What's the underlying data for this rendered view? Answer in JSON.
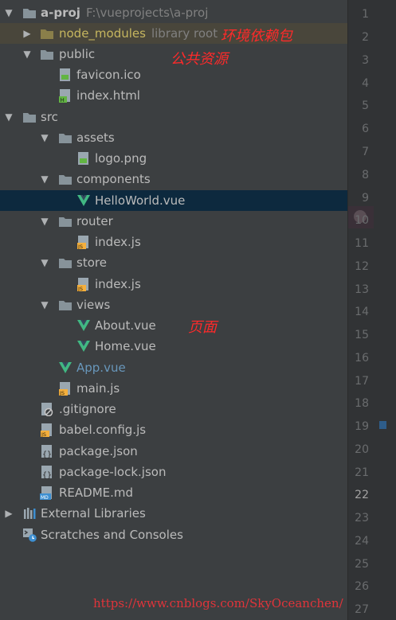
{
  "project": {
    "name": "a-proj",
    "path": "F:\\vueprojects\\a-proj"
  },
  "tree": [
    {
      "label": "node_modules",
      "extra": "library root"
    },
    {
      "label": "public"
    },
    {
      "label": "favicon.ico"
    },
    {
      "label": "index.html"
    },
    {
      "label": "src"
    },
    {
      "label": "assets"
    },
    {
      "label": "logo.png"
    },
    {
      "label": "components"
    },
    {
      "label": "HelloWorld.vue"
    },
    {
      "label": "router"
    },
    {
      "label": "index.js"
    },
    {
      "label": "store"
    },
    {
      "label": "index.js"
    },
    {
      "label": "views"
    },
    {
      "label": "About.vue"
    },
    {
      "label": "Home.vue"
    },
    {
      "label": "App.vue"
    },
    {
      "label": "main.js"
    },
    {
      "label": ".gitignore"
    },
    {
      "label": "babel.config.js"
    },
    {
      "label": "package.json"
    },
    {
      "label": "package-lock.json"
    },
    {
      "label": "README.md"
    },
    {
      "label": "External Libraries"
    },
    {
      "label": "Scratches and Consoles"
    }
  ],
  "annotations": {
    "deps": "环境依赖包",
    "public": "公共资源",
    "pages": "页面"
  },
  "line_numbers": [
    "1",
    "2",
    "3",
    "4",
    "5",
    "6",
    "7",
    "8",
    "9",
    "10",
    "11",
    "12",
    "13",
    "14",
    "15",
    "16",
    "17",
    "18",
    "19",
    "20",
    "21",
    "22",
    "23",
    "24",
    "25",
    "26",
    "27"
  ],
  "current_line": "22",
  "watermark": "https://www.cnblogs.com/SkyOceanchen/",
  "colors": {
    "background": "#3c3f41",
    "gutter": "#313335",
    "selection": "#0d293e",
    "excluded_highlight": "#49463b",
    "vue_green": "#41b883",
    "annotation_red": "#ff2a2a"
  }
}
